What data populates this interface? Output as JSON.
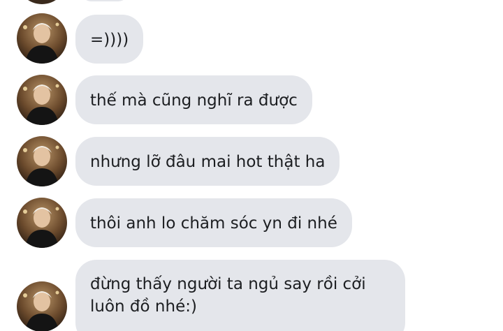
{
  "conversation": {
    "messages": [
      {
        "text": "=))))"
      },
      {
        "text": "thế mà cũng nghĩ ra được"
      },
      {
        "text": "nhưng lỡ đâu mai hot thật ha"
      },
      {
        "text": "thôi anh lo chăm sóc yn đi nhé"
      },
      {
        "text": "đừng thấy người ta ngủ say rồi cởi luôn đồ nhé:)"
      }
    ]
  },
  "colors": {
    "bubble_background": "#e4e6eb",
    "message_text": "#1c1e21",
    "page_background": "#ffffff"
  },
  "icons": {
    "avatar": "profile-photo-avatar"
  }
}
